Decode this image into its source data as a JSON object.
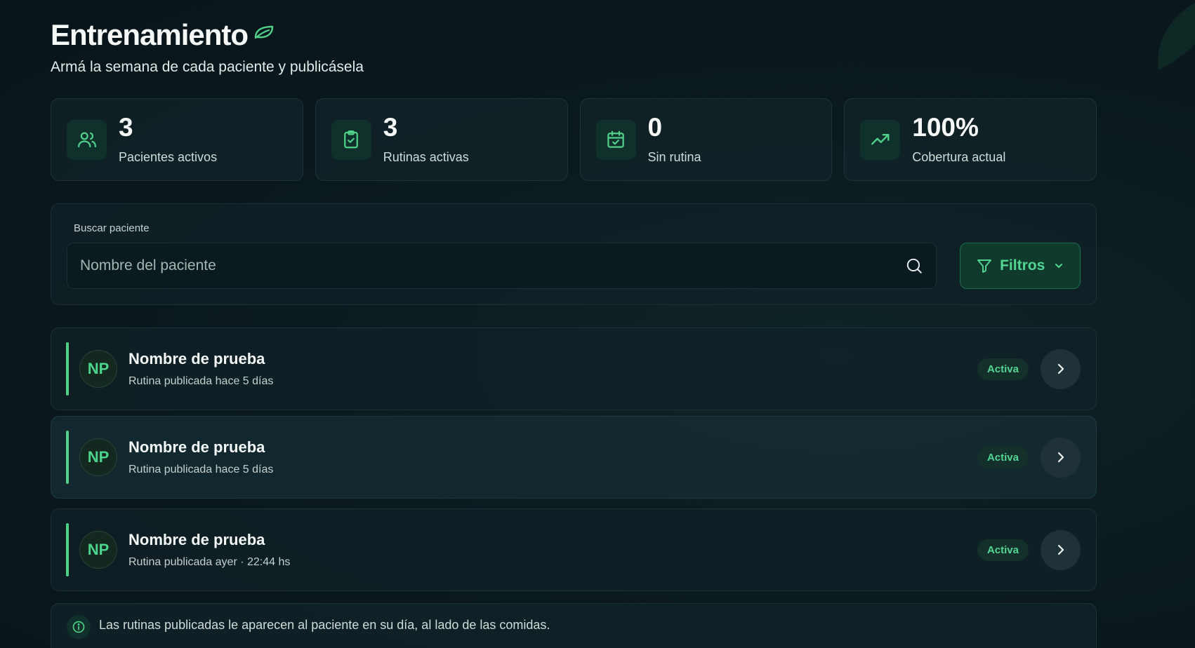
{
  "header": {
    "title": "Entrenamiento",
    "subtitle": "Armá la semana de cada paciente y publicásela"
  },
  "stats": [
    {
      "value": "3",
      "label": "Pacientes activos",
      "icon": "users-icon"
    },
    {
      "value": "3",
      "label": "Rutinas activas",
      "icon": "clipboard-check-icon"
    },
    {
      "value": "0",
      "label": "Sin rutina",
      "icon": "calendar-check-icon"
    },
    {
      "value": "100%",
      "label": "Cobertura actual",
      "icon": "trending-up-icon"
    }
  ],
  "search": {
    "label": "Buscar paciente",
    "placeholder": "Nombre del paciente",
    "value": "",
    "filter_label": "Filtros"
  },
  "patients": [
    {
      "initials": "NP",
      "name": "Nombre de prueba",
      "subtitle": "Rutina publicada hace 5 días",
      "status": "Activa"
    },
    {
      "initials": "NP",
      "name": "Nombre de prueba",
      "subtitle": "Rutina publicada hace 5 días",
      "status": "Activa"
    },
    {
      "initials": "NP",
      "name": "Nombre de prueba",
      "subtitle": "Rutina publicada ayer · 22:44 hs",
      "status": "Activa"
    }
  ],
  "info": {
    "text": "Las rutinas publicadas le aparecen al paciente en su día, al lado de las comidas."
  },
  "colors": {
    "accent": "#52d592",
    "background": "#0b1a1f",
    "card": "#12242a"
  }
}
